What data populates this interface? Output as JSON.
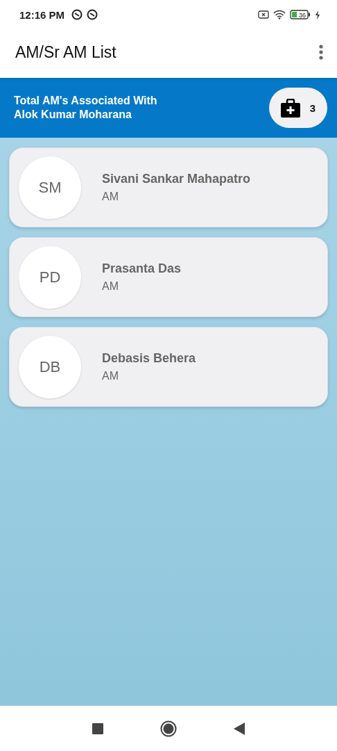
{
  "status_bar": {
    "time": "12:16 PM",
    "battery": "36"
  },
  "app_bar": {
    "title": "AM/Sr AM List"
  },
  "banner": {
    "lines": [
      "Total AM's Associated With",
      "Alok Kumar Moharana"
    ],
    "count": "3"
  },
  "people": [
    {
      "initials": "SM",
      "name": "Sivani Sankar Mahapatro",
      "role": "AM"
    },
    {
      "initials": "PD",
      "name": "Prasanta Das",
      "role": "AM"
    },
    {
      "initials": "DB",
      "name": "Debasis Behera",
      "role": "AM"
    }
  ]
}
